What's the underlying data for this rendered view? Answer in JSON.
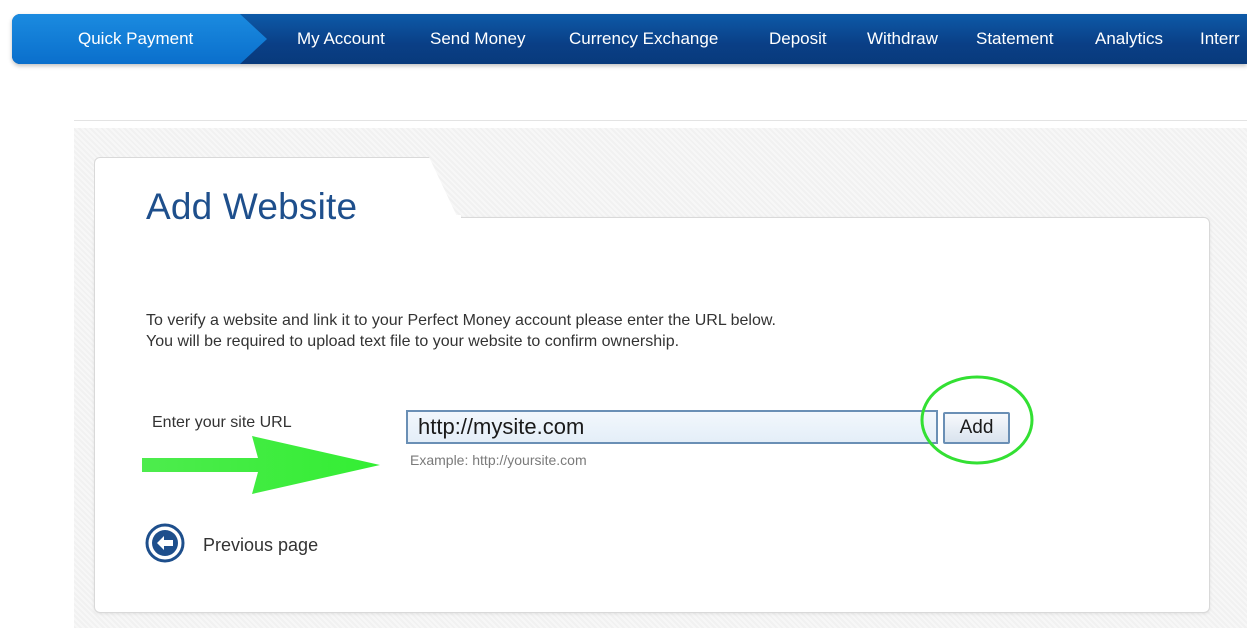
{
  "nav": {
    "quick_payment": "Quick Payment",
    "items": [
      "My Account",
      "Send Money",
      "Currency Exchange",
      "Deposit",
      "Withdraw",
      "Statement",
      "Analytics",
      "Interr"
    ]
  },
  "page": {
    "title": "Add Website",
    "description_line1": "To verify a website and link it to your Perfect Money account please enter the URL below.",
    "description_line2": "You will be required to upload text file to your website to confirm ownership."
  },
  "form": {
    "url_label": "Enter your site URL",
    "url_value": "http://mysite.com",
    "add_label": "Add",
    "example": "Example: http://yoursite.com"
  },
  "footer": {
    "previous_label": "Previous page"
  },
  "colors": {
    "nav_bg": "#0a3f86",
    "quick_payment_bg": "#1b8be0",
    "title": "#1e4f8c",
    "annotation_green": "#2ee82e"
  },
  "icons": {
    "previous": "circle-arrow-left-icon",
    "annotation_arrow": "arrow-right-icon",
    "annotation_circle": "highlight-circle"
  }
}
